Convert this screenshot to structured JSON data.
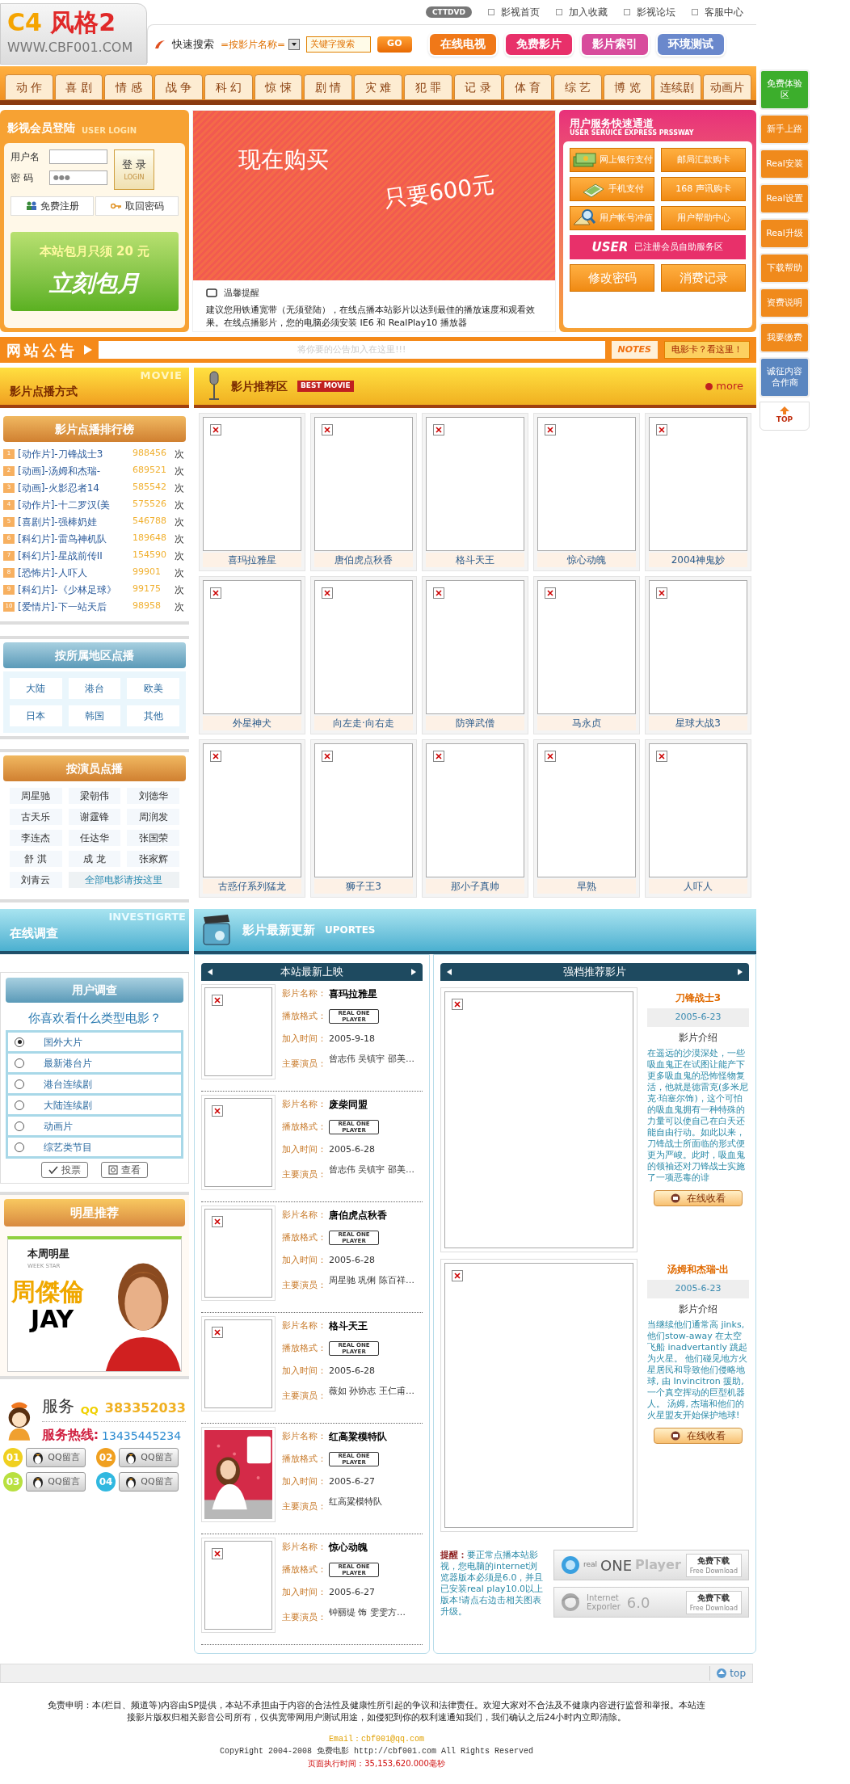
{
  "top_links": {
    "badge": "CTTDVD",
    "items": [
      "影视首页",
      "加入收藏",
      "影视论坛",
      "客服中心"
    ]
  },
  "logo": {
    "part1": "C4",
    "part2": "风格2",
    "url": "WWW.CBF001.COM"
  },
  "search": {
    "label": "快速搜索",
    "select": "=按影片名称=",
    "value": "关键字搜索",
    "button": "GO"
  },
  "header_buttons": [
    {
      "label": "在线电视",
      "color": "#f07818"
    },
    {
      "label": "免费影片",
      "color": "#e8306a"
    },
    {
      "label": "影片索引",
      "color": "#d84c9c"
    },
    {
      "label": "环境测试",
      "color": "#6a88cc"
    }
  ],
  "categories": [
    "动 作",
    "喜 剧",
    "情 感",
    "战 争",
    "科 幻",
    "惊 悚",
    "剧 情",
    "灾 难",
    "犯 罪",
    "记 录",
    "体 育",
    "综 艺",
    "博 览",
    "连续剧",
    "动画片"
  ],
  "sidebar": {
    "items": [
      {
        "label": "免费体验区",
        "color": "#3cae2c"
      },
      {
        "label": "新手上路",
        "color": "#f08a1c"
      },
      {
        "label": "Real安装",
        "color": "#f08a1c"
      },
      {
        "label": "Real设置",
        "color": "#f08a1c"
      },
      {
        "label": "Real升级",
        "color": "#f08a1c"
      },
      {
        "label": "下载帮助",
        "color": "#f08a1c"
      },
      {
        "label": "资费说明",
        "color": "#f08a1c"
      },
      {
        "label": "我要缴费",
        "color": "#f08a1c"
      },
      {
        "label": "诚征内容合作商",
        "color": "#5a86c0"
      }
    ],
    "top": "TOP"
  },
  "login": {
    "title": "影视会员登陆",
    "subtitle": "USER LOGIN",
    "username_label": "用户名",
    "password_label": "密 码",
    "password_dots": "●●●",
    "login_button": "登 录",
    "login_sub": "LOGIN",
    "register": "免费注册",
    "recover": "取回密码",
    "promo_line1": "本站包月只须 20 元",
    "promo_line2": "立刻包月"
  },
  "banner": {
    "line1": "现在购买",
    "line2": "只要600元",
    "tip_title": "温馨提醒",
    "tip": "建议您用铁通宽带（无须登陆），在线点播本站影片以达到最佳的播放速度和观看效果。在线点播影片，您的电脑必须安装 IE6 和 RealPlay10 播放器"
  },
  "service": {
    "title": "用户服务快速通道",
    "subtitle": "USER SERUICE EXPRESS PRSSWAY",
    "buttons": [
      {
        "label": "网上银行支付",
        "kind": "money"
      },
      {
        "label": "邮局汇款购卡",
        "kind": "plain"
      },
      {
        "label": "手机支付",
        "kind": "phone"
      },
      {
        "label": "168 声讯购卡",
        "kind": "plain"
      },
      {
        "label": "用户帐号冲值",
        "kind": "search"
      },
      {
        "label": "用户帮助中心",
        "kind": "plain"
      }
    ],
    "user_tag": "USER",
    "user_label": "已注册会员自助服务区",
    "big_buttons": [
      "修改密码",
      "消费记录"
    ]
  },
  "notice": {
    "label": "网站公告",
    "text": "将你要的公告加入在这里!!!",
    "notes": "NOTES",
    "card_link": "电影卡？看这里！"
  },
  "left_header": {
    "title": "影片点播方式",
    "overlay": "MOVIE"
  },
  "ranking": {
    "title": "影片点播排行榜",
    "rows": [
      {
        "rank": "1",
        "title": "[动作片]-刀锋战士3",
        "count": "988456",
        "unit": "次"
      },
      {
        "rank": "2",
        "title": "[动画]-汤姆和杰瑞-",
        "count": "689521",
        "unit": "次"
      },
      {
        "rank": "3",
        "title": "[动画]-火影忍者14",
        "count": "585542",
        "unit": "次"
      },
      {
        "rank": "4",
        "title": "[动作片]-十二罗汉(美",
        "count": "575526",
        "unit": "次"
      },
      {
        "rank": "5",
        "title": "[喜剧片]-强棒奶娃",
        "count": "546788",
        "unit": "次"
      },
      {
        "rank": "6",
        "title": "[科幻片]-雷鸟神机队",
        "count": "189648",
        "unit": "次"
      },
      {
        "rank": "7",
        "title": "[科幻片]-星战前传II",
        "count": "154590",
        "unit": "次"
      },
      {
        "rank": "8",
        "title": "[恐怖片]-人吓人",
        "count": "99901",
        "unit": "次"
      },
      {
        "rank": "9",
        "title": "[科幻片]-《少林足球》",
        "count": "99175",
        "unit": "次"
      },
      {
        "rank": "10",
        "title": "[爱情片]-下一站天后",
        "count": "98958",
        "unit": "次"
      }
    ]
  },
  "regions": {
    "title": "按所属地区点播",
    "items": [
      "大陆",
      "港台",
      "欧美",
      "日本",
      "韩国",
      "其他"
    ]
  },
  "actors": {
    "title": "按演员点播",
    "items": [
      "周星驰",
      "梁朝伟",
      "刘德华",
      "古天乐",
      "谢霆锋",
      "周润发",
      "李连杰",
      "任达华",
      "张国荣",
      "舒 淇",
      "成 龙",
      "张家辉",
      "刘青云"
    ],
    "all_link": "全部电影请按这里"
  },
  "recommend": {
    "title": "影片推荐区",
    "tag": "BEST MOVIE",
    "more": "more",
    "movies": [
      "喜玛拉雅星",
      "唐伯虎点秋香",
      "格斗天王",
      "惊心动魄",
      "2004神鬼妙",
      "外星神犬",
      "向左走·向右走",
      "防弹武僧",
      "马永贞",
      "星球大战3",
      "古惑仔系列猛龙",
      "狮子王3",
      "那小子真帅",
      "早熟",
      "人吓人"
    ]
  },
  "survey_header": {
    "title": "在线调查",
    "overlay": "INVESTIGRTE"
  },
  "survey": {
    "title": "用户调查",
    "question": "你喜欢看什么类型电影？",
    "options": [
      {
        "label": "国外大片",
        "selected": true
      },
      {
        "label": "最新港台片",
        "selected": false
      },
      {
        "label": "港台连续剧",
        "selected": false
      },
      {
        "label": "大陆连续剧",
        "selected": false
      },
      {
        "label": "动画片",
        "selected": false
      },
      {
        "label": "综艺类节目",
        "selected": false
      }
    ],
    "vote": "投票",
    "view": "查看"
  },
  "star": {
    "title": "明星推荐",
    "tag": "本周明星",
    "tag_sub": "WEEK STAR",
    "name": "周傑倫",
    "name_en": "JAY"
  },
  "contact": {
    "service": "服务",
    "qq_label": "QQ",
    "qq": "383352033",
    "hotline_label": "服务热线:",
    "hotline": "13435445234",
    "qq_buttons": [
      {
        "num": "01",
        "label": "QQ留言",
        "color": "#f0d020"
      },
      {
        "num": "02",
        "label": "QQ留言",
        "color": "#f0a020"
      },
      {
        "num": "03",
        "label": "QQ留言",
        "color": "#b8e040"
      },
      {
        "num": "04",
        "label": "QQ留言",
        "color": "#30b8e0"
      }
    ]
  },
  "updates_header": {
    "title": "影片最新更新",
    "tag": "UPORTES"
  },
  "latest": {
    "title": "本站最新上映",
    "items": [
      {
        "poster_missing": true,
        "name_label": "影片名称：",
        "name": "喜玛拉雅星",
        "format_label": "播放格式：",
        "format": "REAL ONE PLAYER",
        "date_label": "加入时间：",
        "date": "2005-9-18",
        "actors_label": "主要演员：",
        "actors": "曾志伟 吴镇宇 邵美…"
      },
      {
        "poster_missing": true,
        "name_label": "影片名称：",
        "name": "废柴同盟",
        "format_label": "播放格式：",
        "format": "REAL ONE PLAYER",
        "date_label": "加入时间：",
        "date": "2005-6-28",
        "actors_label": "主要演员：",
        "actors": "曾志伟 吴镇宇 邵美…"
      },
      {
        "poster_missing": true,
        "name_label": "影片名称：",
        "name": "唐伯虎点秋香",
        "format_label": "播放格式：",
        "format": "REAL ONE PLAYER",
        "date_label": "加入时间：",
        "date": "2005-6-28",
        "actors_label": "主要演员：",
        "actors": "周星驰 巩俐  陈百祥…"
      },
      {
        "poster_missing": true,
        "name_label": "影片名称：",
        "name": "格斗天王",
        "format_label": "播放格式：",
        "format": "REAL ONE PLAYER",
        "date_label": "加入时间：",
        "date": "2005-6-28",
        "actors_label": "主要演员：",
        "actors": "薇如 孙协志 王仁甫…"
      },
      {
        "poster_missing": false,
        "name_label": "影片名称：",
        "name": "红高粱模特队",
        "format_label": "播放格式：",
        "format": "REAL ONE PLAYER",
        "date_label": "加入时间：",
        "date": "2005-6-27",
        "actors_label": "主要演员：",
        "actors": "红高粱模特队"
      },
      {
        "poster_missing": true,
        "name_label": "影片名称：",
        "name": "惊心动魄",
        "format_label": "播放格式：",
        "format": "REAL ONE PLAYER",
        "date_label": "加入时间：",
        "date": "2005-6-27",
        "actors_label": "主要演员：",
        "actors": "钟丽缇 饰 雯雯方…"
      }
    ]
  },
  "featured": {
    "title": "强档推荐影片",
    "items": [
      {
        "name": "刀锋战士3",
        "date": "2005-6-23",
        "intro_label": "影片介绍",
        "intro": "在遥远的沙漠深处，一些吸血鬼正在试图让能产下更多吸血鬼的恐怖怪物复活，他就是德雷克(多米尼克·珀塞尔饰)，这个可怕的吸血鬼拥有一种特殊的力量可以使自己在白天还能自由行动。如此以来，刀锋战士所面临的形式便更为严峻。此时，吸血鬼的领袖还对刀锋战士实施了一项恶毒的诽",
        "button": "在线收看"
      },
      {
        "name": "汤姆和杰瑞-出",
        "date": "2005-6-23",
        "intro_label": "影片介绍",
        "intro": "当继续他们通常高 jinks, 他们stow-away 在太空飞船 inadvertantly 跳起为火星。 他们碰见地方火星居民和导致他们侵略地球, 由 Invincitron 援助, 一个真空挥动的巨型机器人。 汤姆, 杰瑞和他们的火星盟友开始保护地球!",
        "button": "在线收看"
      }
    ],
    "reminder_label": "提醒：",
    "reminder": "要正常点播本站影视，您电脑的internet浏览器版本必须是6.0，并且已安装real play10.0以上版本!请点右边击相关图表升级。",
    "real": {
      "small": "real",
      "big": "ONE",
      "tail": "Player",
      "download": "免费下载",
      "download_en": "Free Download"
    },
    "ie": {
      "line1": "Internet",
      "line2": "Exporler",
      "version": "6.0",
      "download": "免费下载",
      "download_en": "Free Download"
    }
  },
  "top_bar": {
    "label": "top"
  },
  "footer": {
    "disclaimer": "免责申明：本(栏目、频道等)内容由SP提供，本站不承担由于内容的合法性及健康性所引起的争议和法律责任。欢迎大家对不合法及不健康内容进行监督和举报。本站连接影片版权归相关影音公司所有，仅供宽带网用户测试用途，如侵犯到你的权利速通知我们，我们确认之后24小时内立即清除。",
    "email": "Email：cbf001@qq.com",
    "copyright": "CopyRight 2004-2008 免费电影 http://cbf001.com All Rights Reserved",
    "exec_time": "页面执行时间：35,153,620.000毫秒"
  }
}
